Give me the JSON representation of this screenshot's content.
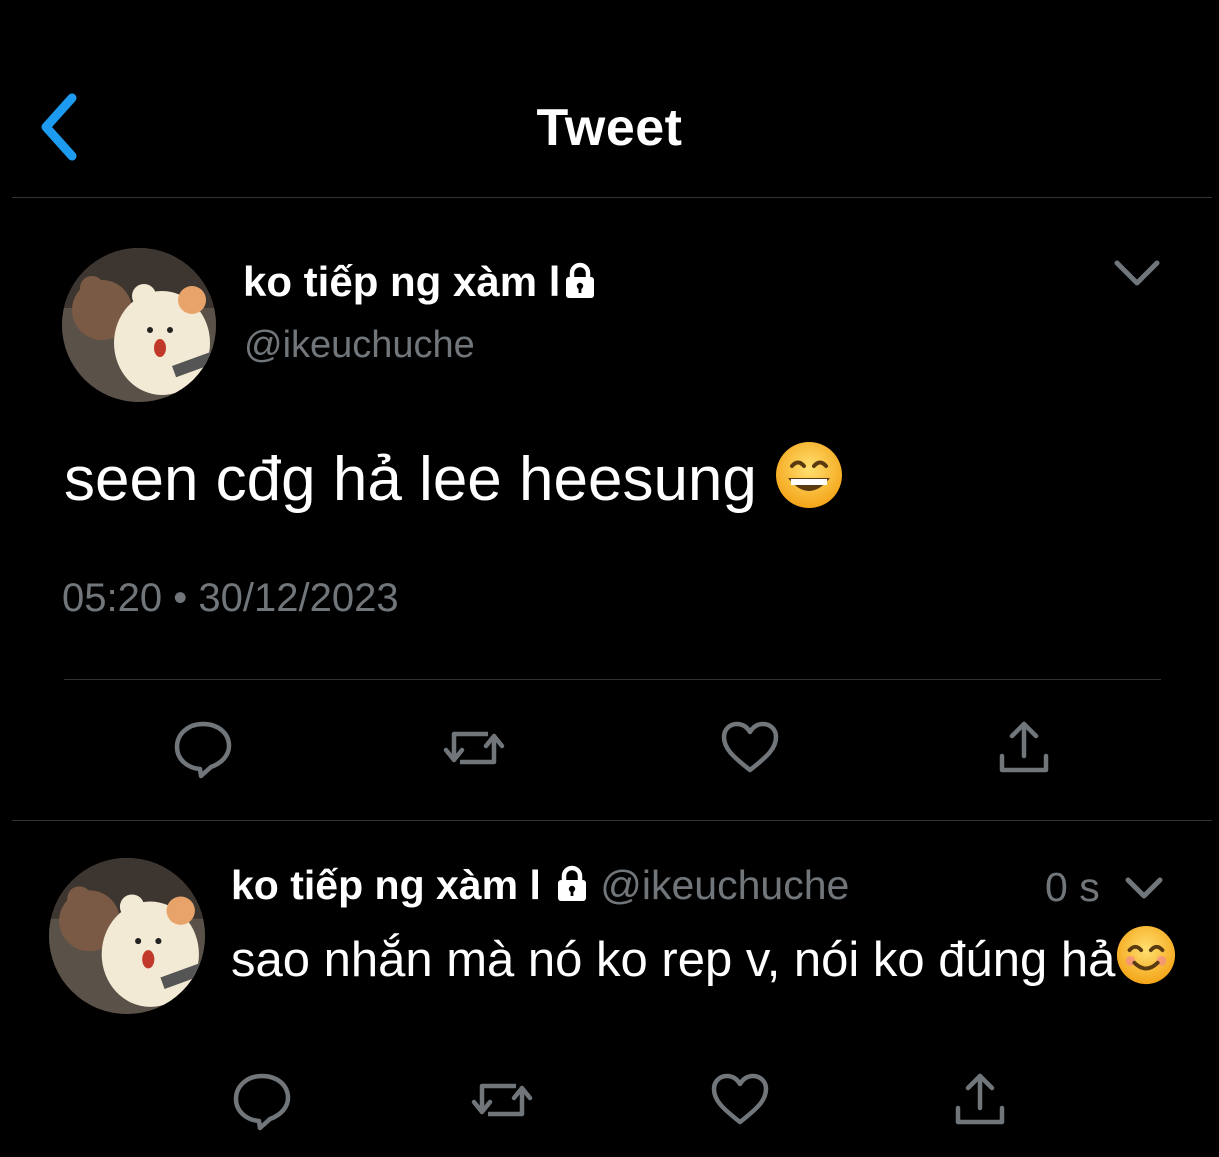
{
  "header": {
    "title": "Tweet"
  },
  "main_tweet": {
    "display_name": "ko tiếp ng xàm l",
    "handle": "@ikeuchuche",
    "text": "seen cđg hả lee heesung",
    "time": "05:20",
    "separator": "•",
    "date": "30/12/2023"
  },
  "reply_tweet": {
    "display_name": "ko tiếp ng xàm l",
    "handle": "@ikeuchuche",
    "time_ago": "0 s",
    "text": "sao nhắn mà nó ko rep v, nói ko đúng hả"
  },
  "icons": {
    "back": "chevron-left-icon",
    "more": "chevron-down-icon",
    "lock": "lock-icon",
    "reply": "reply-icon",
    "retweet": "retweet-icon",
    "like": "heart-icon",
    "share": "share-icon",
    "emoji_main": "grinning-face-emoji",
    "emoji_reply": "smiling-face-emoji"
  },
  "colors": {
    "background": "#000000",
    "accent": "#1d9bf0",
    "muted": "#71767b",
    "divider": "#2f3336"
  }
}
